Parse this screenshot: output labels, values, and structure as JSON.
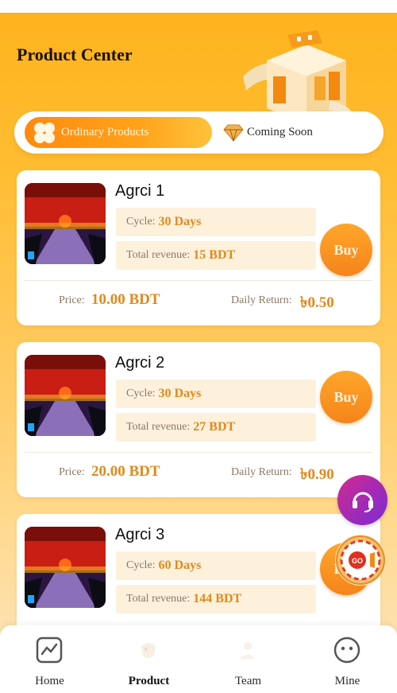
{
  "header": {
    "title": "Product Center"
  },
  "tabs": {
    "ordinary": "Ordinary Products",
    "coming_soon": "Coming Soon"
  },
  "labels": {
    "cycle": "Cycle:",
    "total_revenue": "Total revenue:",
    "price": "Price:",
    "daily_return": "Daily Return:",
    "buy": "Buy"
  },
  "products": [
    {
      "name": "Agrci 1",
      "cycle": "30 Days",
      "total_revenue": "15 BDT",
      "price": "10.00 BDT",
      "daily_return": "৳0.50"
    },
    {
      "name": "Agrci 2",
      "cycle": "30 Days",
      "total_revenue": "27 BDT",
      "price": "20.00 BDT",
      "daily_return": "৳0.90"
    },
    {
      "name": "Agrci 3",
      "cycle": "60 Days",
      "total_revenue": "144 BDT"
    }
  ],
  "floating": {
    "wheel_text": "GO"
  },
  "nav": [
    {
      "label": "Home",
      "icon": "chart-icon"
    },
    {
      "label": "Product",
      "icon": "product-icon",
      "active": true
    },
    {
      "label": "Team",
      "icon": "team-icon"
    },
    {
      "label": "Mine",
      "icon": "face-icon"
    }
  ],
  "colors": {
    "accent": "#f5841a",
    "value": "#e2891b",
    "pill": "#fdf1dc"
  }
}
